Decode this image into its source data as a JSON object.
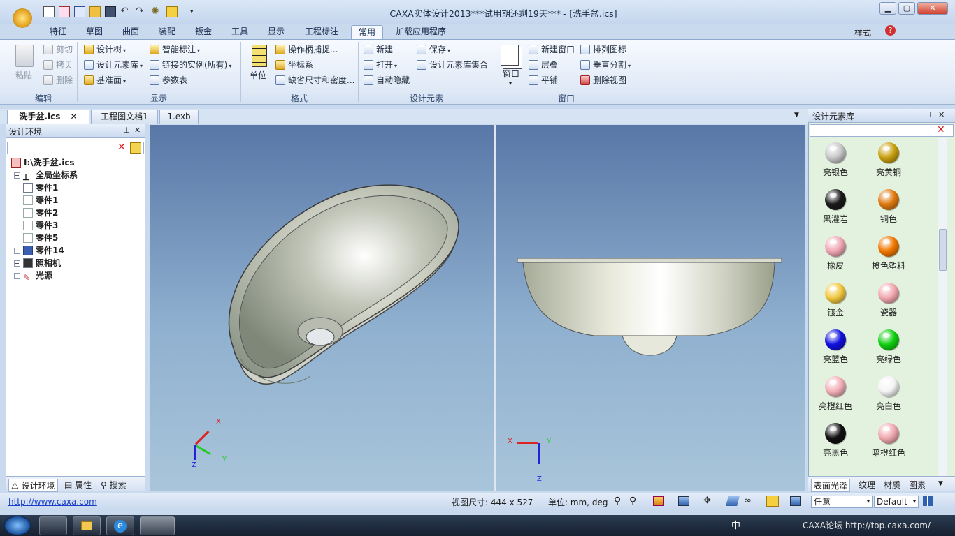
{
  "app": {
    "title": "CAXA实体设计2013***试用期还剩19天*** - [洗手盆.ics]",
    "style_label": "样式"
  },
  "menu_tabs": [
    "特征",
    "草图",
    "曲面",
    "装配",
    "钣金",
    "工具",
    "显示",
    "工程标注",
    "常用",
    "加载应用程序"
  ],
  "ribbon": {
    "edit": {
      "label": "编辑",
      "paste": "粘贴",
      "cut": "剪切",
      "copy": "拷贝",
      "delete": "删除"
    },
    "display": {
      "label": "显示",
      "design_tree": "设计树",
      "design_library": "设计元素库",
      "datum_plane": "基准面",
      "smart_dim": "智能标注",
      "linked_instances": "链接的实例(所有)",
      "param_table": "参数表"
    },
    "format": {
      "label": "格式",
      "unit": "单位",
      "handle_snap": "操作柄捕捉...",
      "coord": "坐标系",
      "default_dim": "缺省尺寸和密度..."
    },
    "design_elem": {
      "label": "设计元素",
      "new": "新建",
      "open": "打开",
      "auto_hide": "自动隐藏",
      "save": "保存",
      "save_lib_set": "设计元素库集合"
    },
    "window": {
      "label": "窗口",
      "window": "窗口",
      "new_window": "新建窗口",
      "cascade": "层叠",
      "tile": "平铺",
      "arrange_icons": "排列图标",
      "vertical_split": "垂直分割",
      "delete_view": "删除视图"
    }
  },
  "doc_tabs": [
    "洗手盆.ics",
    "工程图文档1",
    "1.exb"
  ],
  "left_panel": {
    "title": "设计环境",
    "root": "I:\\洗手盆.ics",
    "items": [
      "全局坐标系",
      "零件1",
      "零件1",
      "零件2",
      "零件3",
      "零件5",
      "零件14",
      "照相机",
      "光源"
    ],
    "bottom_tabs": [
      "设计环境",
      "属性",
      "搜索"
    ]
  },
  "axes": {
    "x": "X",
    "y": "Y",
    "z": "Z"
  },
  "right_panel": {
    "title": "设计元素库",
    "materials": [
      {
        "name": "亮银色",
        "color": "#c8c8c8"
      },
      {
        "name": "亮黄铜",
        "color": "#c9a010"
      },
      {
        "name": "黑灌岩",
        "color": "#1a1a1a"
      },
      {
        "name": "铜色",
        "color": "#e07a10"
      },
      {
        "name": "橡皮",
        "color": "#f0a8b4"
      },
      {
        "name": "橙色塑料",
        "color": "#f07800"
      },
      {
        "name": "镀金",
        "color": "#f2c840"
      },
      {
        "name": "瓷器",
        "color": "#f2a8b0"
      },
      {
        "name": "亮蓝色",
        "color": "#1010e0"
      },
      {
        "name": "亮绿色",
        "color": "#10d010"
      },
      {
        "name": "亮橙红色",
        "color": "#f2b0b8"
      },
      {
        "name": "亮白色",
        "color": "#f4f4f4"
      },
      {
        "name": "亮黑色",
        "color": "#101010"
      },
      {
        "name": "暗橙红色",
        "color": "#f0a8b0"
      }
    ],
    "bottom_tabs": [
      "表面光泽",
      "纹理",
      "材质",
      "图素"
    ]
  },
  "status": {
    "url": "http://www.caxa.com",
    "view_size": "视图尺寸: 444 x 527",
    "unit": "单位: mm, deg",
    "select1": "任意",
    "select2": "Default"
  },
  "taskbar": {
    "tray_text": "中",
    "watermark": "CAXA论坛 http://top.caxa.com/"
  }
}
